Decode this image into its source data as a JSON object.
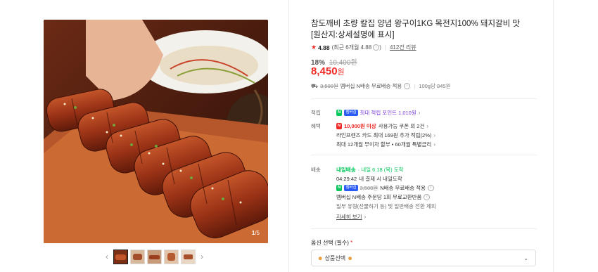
{
  "gallery": {
    "page_current": "1",
    "page_total": "/5",
    "prev_arrow": "‹",
    "next_arrow": "›"
  },
  "product": {
    "title": "참도깨비 초량 칼집 양념 왕구이1KG 목전지100% 돼지갈비 맛 [원산지:상세설명에 표시]",
    "rating_score": "4.88",
    "rating_recent": "(최근 6개월 4.88",
    "reviews_count": "412건 리뷰",
    "discount_rate": "18%",
    "original_price": "10,400원",
    "price_number": "8,450",
    "price_unit": "원",
    "shipping_original": "3,500원",
    "shipping_text": "멤버십 N배송 무료배송 적용",
    "unit_price": "100g당 845원"
  },
  "points": {
    "label": "적립",
    "member_badge": "멤버십",
    "text": "최대 적립 포인트 1,010원"
  },
  "benefits": {
    "label": "혜택",
    "coupon_amount": "10,000원 이상",
    "coupon_text": "사용가능 쿠폰 외 2건",
    "card_text": "라인프렌즈 카드 최대 169원 추가 적립(2%)",
    "installment_text": "최대 12개월 무이자 할부 • 60개월 특별금리"
  },
  "delivery": {
    "label": "배송",
    "tomorrow_badge": "내일배송",
    "arrival": "· 내일 6.18 (목) 도착",
    "countdown": "04:29:42",
    "countdown_text": "내 결제 시 내일도착",
    "free_original": "3,500원",
    "free_text": "N배송 무료배송 적용",
    "return_text": "멤버십 N배송 주문당 1회 무료교환반품",
    "note": "일부 유형(선물하기 등) 및 일반배송 전환 제외",
    "more_link": "자세히 보기"
  },
  "options": {
    "label": "옵션 선택 (필수)",
    "required_mark": "*",
    "selected": "상품선택"
  },
  "colors": {
    "accent_red": "#f02a26",
    "npay_green": "#03c75a",
    "purple": "#7b3fd9"
  },
  "icons": {
    "star": "★",
    "info": "i",
    "chevron": "›",
    "truck": "⛟"
  }
}
